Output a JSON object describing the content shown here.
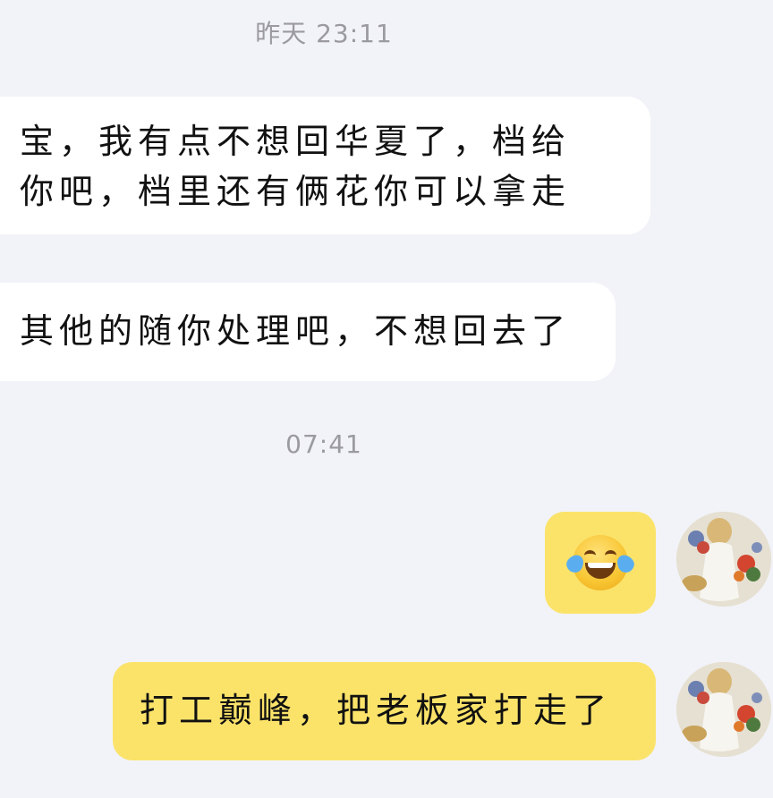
{
  "messages": [
    {
      "type": "timestamp",
      "text": "昨天 23:11"
    },
    {
      "type": "incoming",
      "text": "宝，我有点不想回华夏了，档给你吧，档里还有俩花你可以拿走"
    },
    {
      "type": "incoming",
      "text": "其他的随你处理吧，不想回去了"
    },
    {
      "type": "timestamp",
      "text": "07:41"
    },
    {
      "type": "outgoing",
      "emoji": "face-with-tears-of-joy-icon"
    },
    {
      "type": "outgoing",
      "text": "打工巅峰，把老板家打走了"
    }
  ],
  "colors": {
    "background": "#f2f3f8",
    "incoming_bubble": "#ffffff",
    "outgoing_bubble": "#fbe36a",
    "timestamp_text": "#9a9aa0"
  }
}
